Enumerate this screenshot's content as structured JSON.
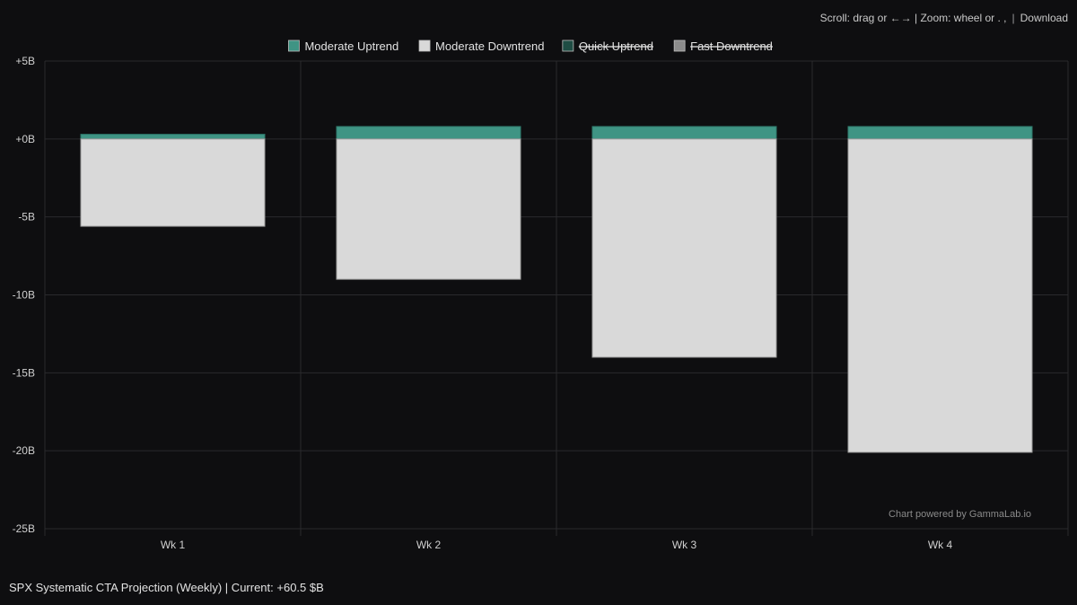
{
  "toolbar": {
    "hint": "Scroll: drag or ←→ | Zoom: wheel or . ,",
    "separator": "|",
    "download_label": "Download"
  },
  "footer": {
    "title": "SPX Systematic CTA Projection (Weekly) | Current: +60.5 $B"
  },
  "watermark": "Chart powered by GammaLab.io",
  "colors": {
    "background": "#0e0e10",
    "grid": "#2a2a2d",
    "moderate_uptrend": "#3f9484",
    "moderate_downtrend": "#d9d9d9",
    "quick_uptrend": "#1f4d44",
    "fast_downtrend": "#8c8c8c"
  },
  "chart_data": {
    "type": "bar",
    "stacked": true,
    "categories": [
      "Wk 1",
      "Wk 2",
      "Wk 3",
      "Wk 4"
    ],
    "series": [
      {
        "name": "Moderate Uptrend",
        "values": [
          0.3,
          0.8,
          0.8,
          0.8
        ],
        "color": "#3f9484",
        "hidden": false
      },
      {
        "name": "Moderate Downtrend",
        "values": [
          -5.6,
          -9.0,
          -14.0,
          -20.1
        ],
        "color": "#d9d9d9",
        "hidden": false
      },
      {
        "name": "Quick Uptrend",
        "values": [],
        "color": "#1f4d44",
        "hidden": true
      },
      {
        "name": "Fast Downtrend",
        "values": [],
        "color": "#8c8c8c",
        "hidden": true
      }
    ],
    "ylim": [
      -25,
      5
    ],
    "yticks": [
      5,
      0,
      -5,
      -10,
      -15,
      -20,
      -25
    ],
    "ytick_labels": [
      "+5B",
      "+0B",
      "-5B",
      "-10B",
      "-15B",
      "-20B",
      "-25B"
    ],
    "grid": true,
    "legend_position": "top-center"
  }
}
